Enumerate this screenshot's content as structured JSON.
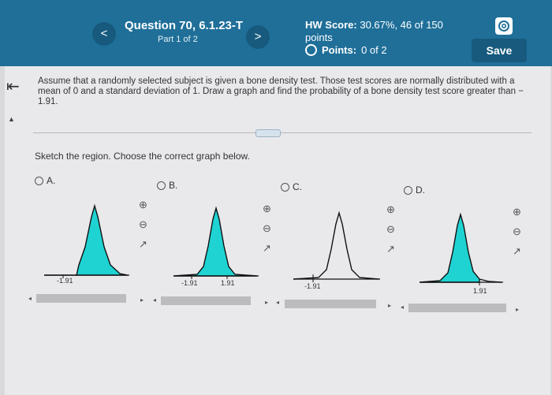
{
  "header": {
    "prev_label": "<",
    "next_label": ">",
    "question_title": "Question 70, 6.1.23-T",
    "part": "Part 1 of 2",
    "hw_score_label": "HW Score:",
    "hw_score_value": "30.67%, 46 of 150",
    "hw_points_word": "points",
    "points_label": "Points:",
    "points_value": "0 of 2",
    "save_label": "Save"
  },
  "problem_text": "Assume that a randomly selected subject is given a bone density test. Those test scores are normally distributed with a mean of 0 and a standard deviation of 1. Draw a graph and find the probability of a bone density test score greater than − 1.91.",
  "instruction": "Sketch the region. Choose the correct graph below.",
  "options": [
    {
      "label": "A.",
      "shading": "left of -1.91",
      "tick_labels": [
        "-1.91"
      ]
    },
    {
      "label": "B.",
      "shading": "between -1.91 and 1.91",
      "tick_labels": [
        "-1.91",
        "1.91"
      ]
    },
    {
      "label": "C.",
      "shading": "none",
      "tick_labels": [
        "-1.91"
      ]
    },
    {
      "label": "D.",
      "shading": "left of 1.91",
      "tick_labels": [
        "1.91"
      ]
    }
  ],
  "colors": {
    "header": "#1f6f99",
    "shade": "#1fd3d3"
  }
}
